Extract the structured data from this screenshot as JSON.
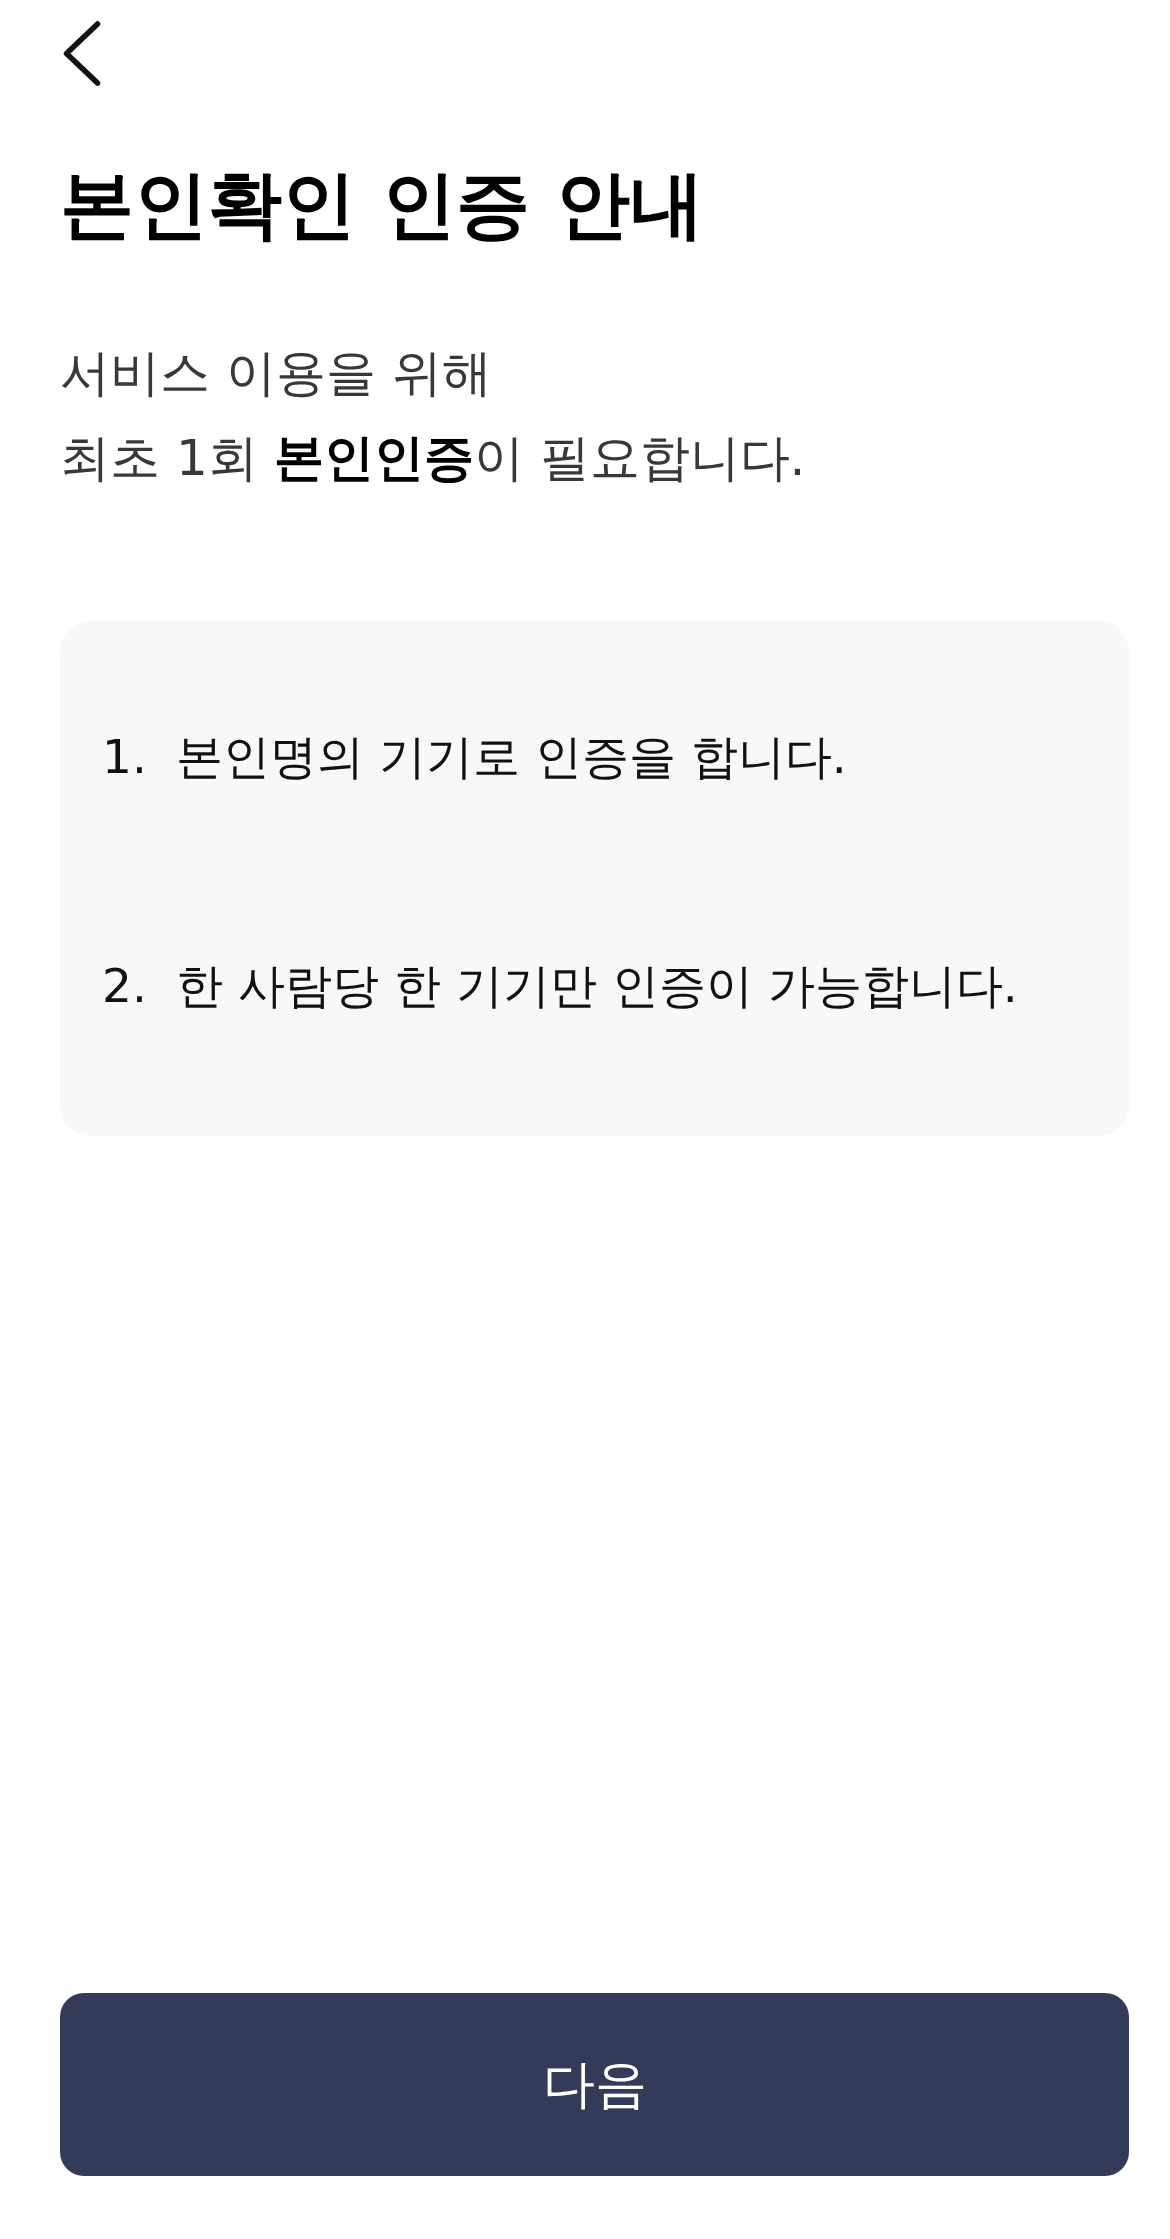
{
  "title": "본인확인 인증 안내",
  "intro": {
    "lines": [
      "서비스 이용을 위해",
      "최초 1회 **본인인증**이 필요합니다."
    ]
  },
  "notice": [
    {
      "number": "1.",
      "text": "본인명의 기기로 인증을 합니다."
    },
    {
      "number": "2.",
      "text": "한 사람당 한 기기만 인증이 가능합니다."
    }
  ],
  "primary_button": {
    "label": "다음"
  }
}
